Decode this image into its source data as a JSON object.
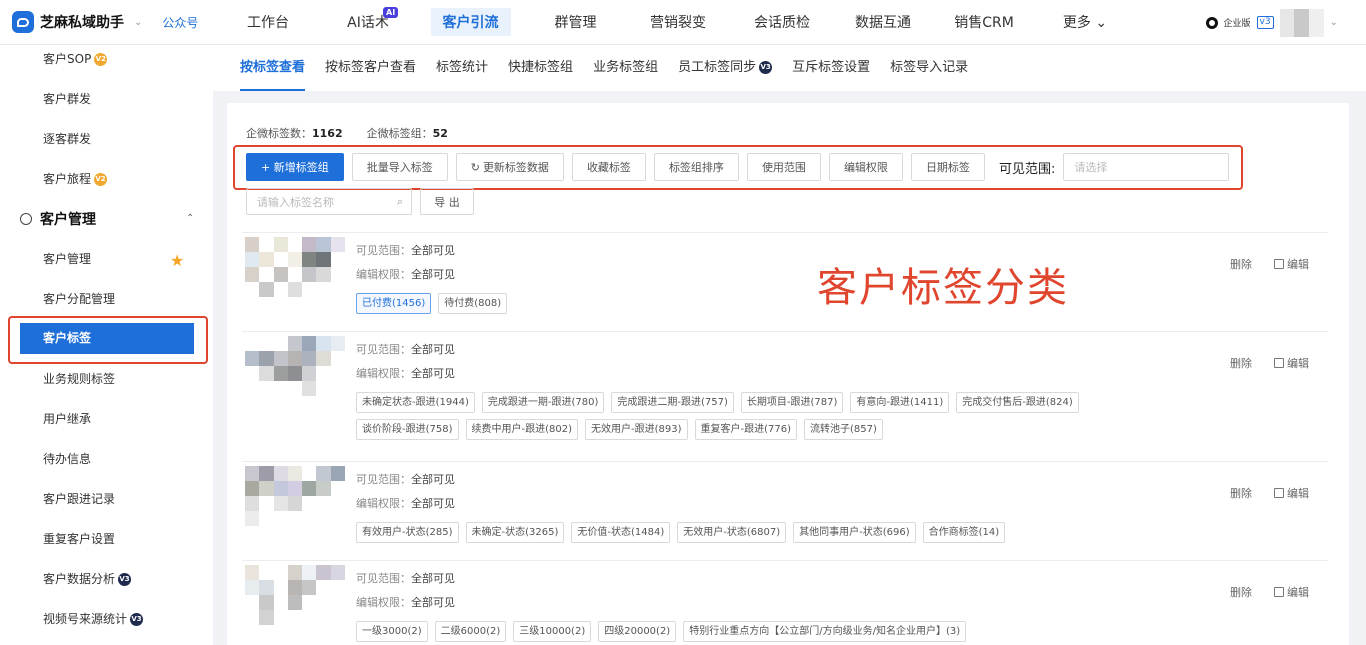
{
  "brand": {
    "name": "芝麻私域助手",
    "sub": "公众号"
  },
  "nav": [
    {
      "label": "工作台"
    },
    {
      "label": "AI话术",
      "badge": "AI"
    },
    {
      "label": "客户引流",
      "active": true
    },
    {
      "label": "群管理"
    },
    {
      "label": "营销裂变"
    },
    {
      "label": "会话质检"
    },
    {
      "label": "数据互通"
    },
    {
      "label": "销售CRM"
    },
    {
      "label": "更多 ⌄"
    }
  ],
  "account": {
    "edition": "企业版",
    "version": "v3"
  },
  "sidebar": {
    "items_top": [
      {
        "label": "客户SOP",
        "badge": "V2"
      },
      {
        "label": "客户群发"
      },
      {
        "label": "逐客群发"
      },
      {
        "label": "客户旅程",
        "badge": "V2"
      }
    ],
    "group": "客户管理",
    "items_group": [
      {
        "label": "客户管理",
        "starred": true
      },
      {
        "label": "客户分配管理"
      },
      {
        "label": "客户标签",
        "active": true
      },
      {
        "label": "业务规则标签"
      },
      {
        "label": "用户继承"
      },
      {
        "label": "待办信息"
      },
      {
        "label": "客户跟进记录"
      },
      {
        "label": "重复客户设置"
      },
      {
        "label": "客户数据分析",
        "badge": "V3"
      },
      {
        "label": "视频号来源统计",
        "badge": "V3"
      }
    ]
  },
  "subtabs": [
    {
      "label": "按标签查看",
      "active": true
    },
    {
      "label": "按标签客户查看"
    },
    {
      "label": "标签统计"
    },
    {
      "label": "快捷标签组"
    },
    {
      "label": "业务标签组"
    },
    {
      "label": "员工标签同步",
      "badge": "V3"
    },
    {
      "label": "互斥标签设置"
    },
    {
      "label": "标签导入记录"
    }
  ],
  "stats": {
    "tag_count_label": "企微标签数：",
    "tag_count": "1162",
    "group_count_label": "企微标签组：",
    "group_count": "52"
  },
  "toolbar": {
    "add": "+ 新增标签组",
    "import": "批量导入标签",
    "refresh": "更新标签数据",
    "favorite": "收藏标签",
    "sort": "标签组排序",
    "scope": "使用范围",
    "permission": "编辑权限",
    "date_tag": "日期标签",
    "visible_label": "可见范围:",
    "visible_placeholder": "请选择"
  },
  "search": {
    "placeholder": "请输入标签名称",
    "export": "导 出"
  },
  "overlay_title": "客户标签分类",
  "row_labels": {
    "visible": "可见范围：",
    "edit": "编辑权限：",
    "delete": "删除",
    "edit_action": "编辑"
  },
  "groups": [
    {
      "visible": "全部可见",
      "edit": "全部可见",
      "tags": [
        "已付费(1456)",
        "待付费(808)"
      ],
      "selected": 0
    },
    {
      "visible": "全部可见",
      "edit": "全部可见",
      "tags": [
        "未确定状态-跟进(1944)",
        "完成跟进一期-跟进(780)",
        "完成跟进二期-跟进(757)",
        "长期项目-跟进(787)",
        "有意向-跟进(1411)",
        "完成交付售后-跟进(824)",
        "谈价阶段-跟进(758)",
        "续费中用户-跟进(802)",
        "无效用户-跟进(893)",
        "重复客户-跟进(776)",
        "流转池子(857)"
      ]
    },
    {
      "visible": "全部可见",
      "edit": "全部可见",
      "tags": [
        "有效用户-状态(285)",
        "未确定-状态(3265)",
        "无价值-状态(1484)",
        "无效用户-状态(6807)",
        "其他同事用户-状态(696)",
        "合作商标签(14)"
      ]
    },
    {
      "visible": "全部可见",
      "edit": "全部可见",
      "tags": [
        "一级3000(2)",
        "二级6000(2)",
        "三级10000(2)",
        "四级20000(2)",
        "特别行业重点方向【公立部门/方向级业务/知名企业用户】(3)"
      ]
    }
  ]
}
